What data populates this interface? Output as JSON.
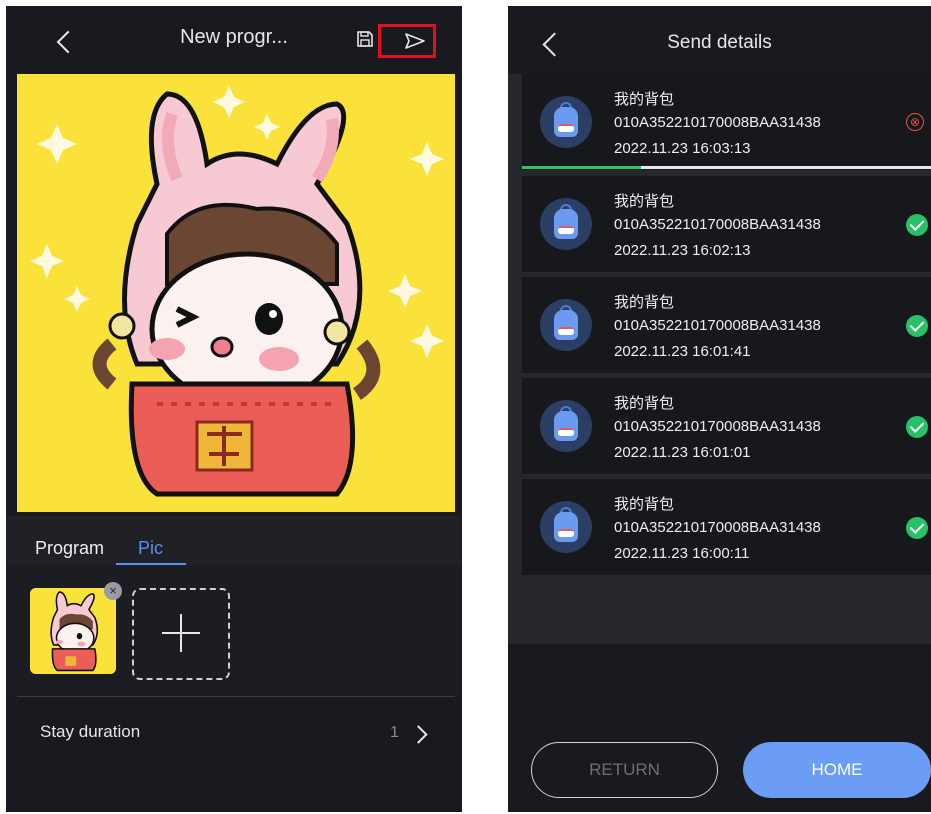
{
  "left_screen": {
    "title": "New progr...",
    "icons": {
      "back": "chevron-left-icon",
      "save": "floppy-disk-icon",
      "send": "send-arrow-icon"
    },
    "highlight_color": "#e0101e",
    "tabs": [
      {
        "label": "Program"
      },
      {
        "label": "Pic",
        "active": true
      }
    ],
    "active_tab_color": "#5b8ff0",
    "thumb_close": "×",
    "stay_duration": {
      "label": "Stay duration",
      "value": "1"
    }
  },
  "right_screen": {
    "title": "Send details",
    "items": [
      {
        "name": "我的背包",
        "device_id": "010A352210170008BAA31438",
        "time": "2022.11.23 16:03:13",
        "status": "failed",
        "status_glyph": "⊗",
        "progress": 0.29
      },
      {
        "name": "我的背包",
        "device_id": "010A352210170008BAA31438",
        "time": "2022.11.23 16:02:13",
        "status": "success"
      },
      {
        "name": "我的背包",
        "device_id": "010A352210170008BAA31438",
        "time": "2022.11.23 16:01:41",
        "status": "success"
      },
      {
        "name": "我的背包",
        "device_id": "010A352210170008BAA31438",
        "time": "2022.11.23 16:01:01",
        "status": "success"
      },
      {
        "name": "我的背包",
        "device_id": "010A352210170008BAA31438",
        "time": "2022.11.23 16:00:11",
        "status": "success"
      }
    ],
    "buttons": {
      "return": "RETURN",
      "home": "HOME"
    },
    "colors": {
      "success": "#27c266",
      "fail": "#e2563f",
      "primary": "#6b9df5"
    }
  }
}
